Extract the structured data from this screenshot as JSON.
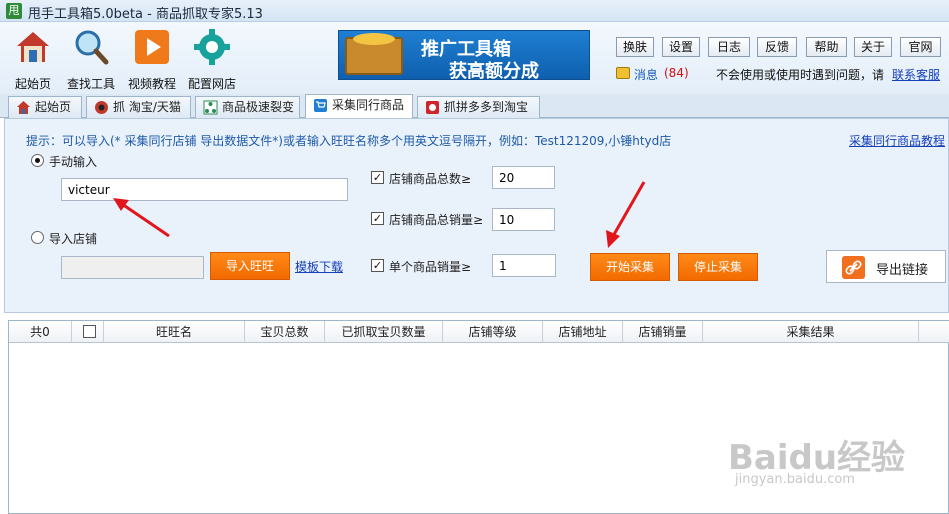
{
  "window": {
    "app_icon": "甩",
    "title": "甩手工具箱5.0beta - 商品抓取专家5.13"
  },
  "toolbar": {
    "tools": [
      {
        "label": "起始页",
        "icon": "home-icon"
      },
      {
        "label": "查找工具",
        "icon": "magnifier-icon"
      },
      {
        "label": "视频教程",
        "icon": "play-icon"
      },
      {
        "label": "配置网店",
        "icon": "gear-icon"
      }
    ],
    "banner": {
      "line1": "推广工具箱",
      "line2": "获高额分成"
    },
    "buttons": [
      "换肤",
      "设置",
      "日志",
      "反馈",
      "帮助",
      "关于",
      "官网"
    ],
    "message_label": "消息",
    "message_count": "(84)",
    "help_text": "不会使用或使用时遇到问题，请",
    "help_link": "联系客服"
  },
  "tabs": [
    {
      "label": "起始页",
      "icon": "home-icon",
      "color": "#c0392b"
    },
    {
      "label": "抓 淘宝/天猫",
      "icon": "spider-icon",
      "color": "#c0392b"
    },
    {
      "label": "商品极速裂变",
      "icon": "split-icon",
      "color": "#2e8b57"
    },
    {
      "label": "采集同行商品",
      "icon": "cart-icon",
      "color": "#1f7fd2"
    },
    {
      "label": "抓拼多多到淘宝",
      "icon": "pdd-icon",
      "color": "#d0242b"
    }
  ],
  "panel": {
    "hint": "提示：可以导入(* 采集同行店铺 导出数据文件*)或者输入旺旺名称多个用英文逗号隔开，例如：Test121209,小锤htyd店",
    "tutorial_link": "采集同行商品教程",
    "manual_label": "手动输入",
    "manual_value": "victeur",
    "import_label": "导入店铺",
    "import_value": "",
    "import_button": "导入旺旺",
    "template_link": "模板下载",
    "filters": [
      {
        "label": "店铺商品总数≥",
        "value": "20",
        "checked": true
      },
      {
        "label": "店铺商品总销量≥",
        "value": "10",
        "checked": true
      },
      {
        "label": "单个商品销量≥",
        "value": "1",
        "checked": true
      }
    ],
    "start_button": "开始采集",
    "stop_button": "停止采集",
    "export_button": "导出链接"
  },
  "table": {
    "columns": [
      "共0",
      "",
      "旺旺名",
      "宝贝总数",
      "已抓取宝贝数量",
      "店铺等级",
      "店铺地址",
      "店铺销量",
      "采集结果"
    ]
  },
  "watermark": {
    "text": "Baidu经验",
    "url": "jingyan.baidu.com"
  },
  "colors": {
    "accent": "#f27a0c",
    "link": "#1540b8",
    "annotation_arrow": "#e0161c"
  }
}
